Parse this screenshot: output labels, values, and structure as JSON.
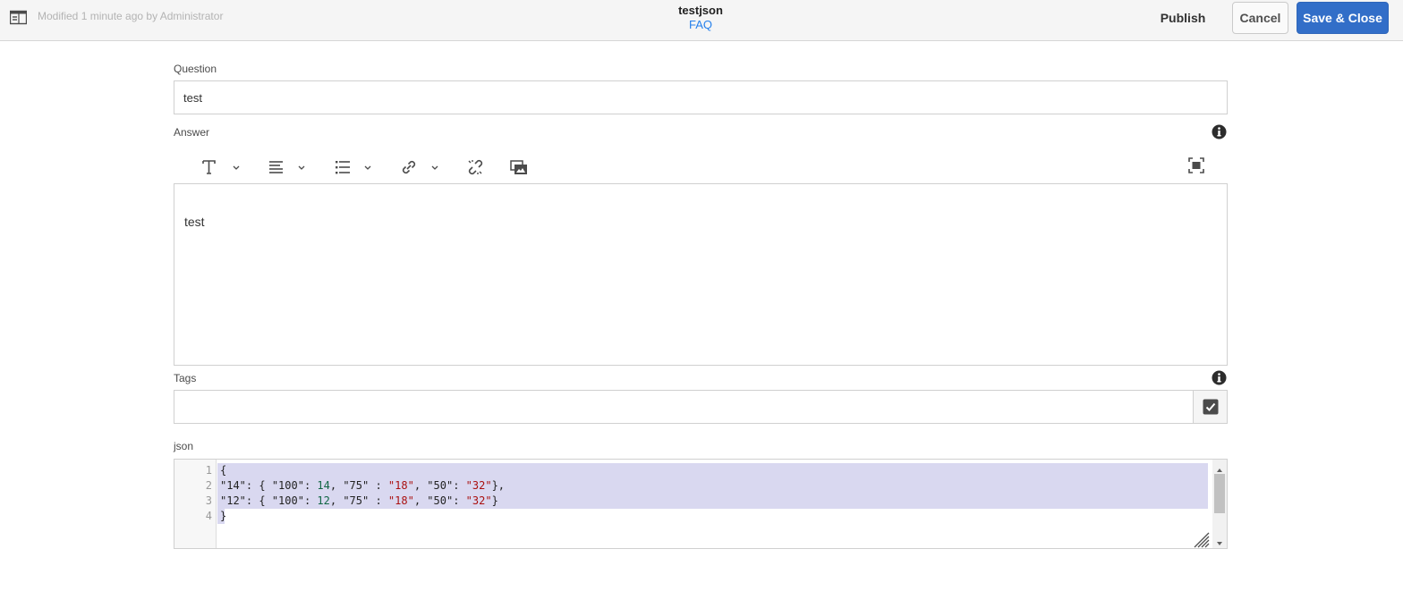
{
  "header": {
    "modified_text": "Modified 1 minute ago by Administrator",
    "title": "testjson",
    "subtitle": "FAQ",
    "publish_label": "Publish",
    "cancel_label": "Cancel",
    "save_close_label": "Save & Close",
    "icons": {
      "panel_toggle": "side-panel-icon"
    }
  },
  "form": {
    "question": {
      "label": "Question",
      "value": "test"
    },
    "answer": {
      "label": "Answer",
      "text": "test",
      "toolbar": [
        "text-format-icon",
        "paragraph-align-icon",
        "list-icon",
        "link-icon",
        "unlink-icon",
        "image-icon",
        "fullscreen-icon"
      ]
    },
    "tags": {
      "label": "Tags",
      "value": ""
    },
    "json": {
      "label": "json",
      "line_numbers": [
        "1",
        "2",
        "3",
        "4"
      ],
      "lines": [
        "{",
        "\"14\": { \"100\": 14, \"75\" : \"18\", \"50\": \"32\"},",
        "\"12\": { \"100\": 12, \"75\" : \"18\", \"50\": \"32\"}",
        "}"
      ]
    }
  },
  "colors": {
    "accent": "#326ec8",
    "link": "#2680eb",
    "selection": "#d9d8f0",
    "code_number": "#116644",
    "code_string": "#aa1111"
  }
}
